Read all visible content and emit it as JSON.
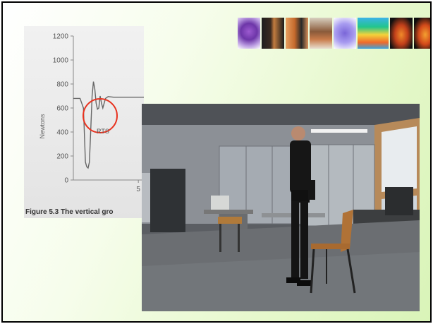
{
  "chart_data": {
    "type": "line",
    "ylabel": "Newtons",
    "ylim": [
      0,
      1200
    ],
    "xlim": [
      0,
      5.5
    ],
    "y_ticks": [
      "1200",
      "1000",
      "800",
      "600",
      "400",
      "200",
      "0"
    ],
    "x_ticks": [
      "5"
    ],
    "series": [
      {
        "points": [
          [
            0.0,
            680
          ],
          [
            0.25,
            680
          ],
          [
            0.5,
            680
          ],
          [
            0.75,
            600
          ],
          [
            0.8,
            460
          ],
          [
            0.85,
            300
          ],
          [
            0.9,
            150
          ],
          [
            1.0,
            110
          ],
          [
            1.1,
            100
          ],
          [
            1.2,
            150
          ],
          [
            1.3,
            420
          ],
          [
            1.4,
            700
          ],
          [
            1.5,
            820
          ],
          [
            1.6,
            760
          ],
          [
            1.7,
            640
          ],
          [
            1.8,
            590
          ],
          [
            1.9,
            600
          ],
          [
            2.0,
            700
          ],
          [
            2.1,
            640
          ],
          [
            2.2,
            600
          ],
          [
            2.4,
            680
          ],
          [
            2.6,
            695
          ],
          [
            3.0,
            690
          ],
          [
            3.5,
            690
          ],
          [
            4.0,
            690
          ],
          [
            5.0,
            690
          ],
          [
            5.5,
            690
          ]
        ]
      }
    ],
    "annotation": "RTS",
    "caption": "Figure 5.3 The vertical gro"
  },
  "image_strip": {
    "thumbnails": [
      "molecule-image",
      "legs-photo",
      "legs-photo",
      "seated-person-photo",
      "molecule-image",
      "spectrum-chart",
      "body-thermal-image",
      "body-thermal-image"
    ]
  },
  "video_frame": {
    "subject": "man-standing-by-chair"
  },
  "colors": {
    "highlight_circle": "#e8321f",
    "slide_background": "#e6f8cc"
  }
}
